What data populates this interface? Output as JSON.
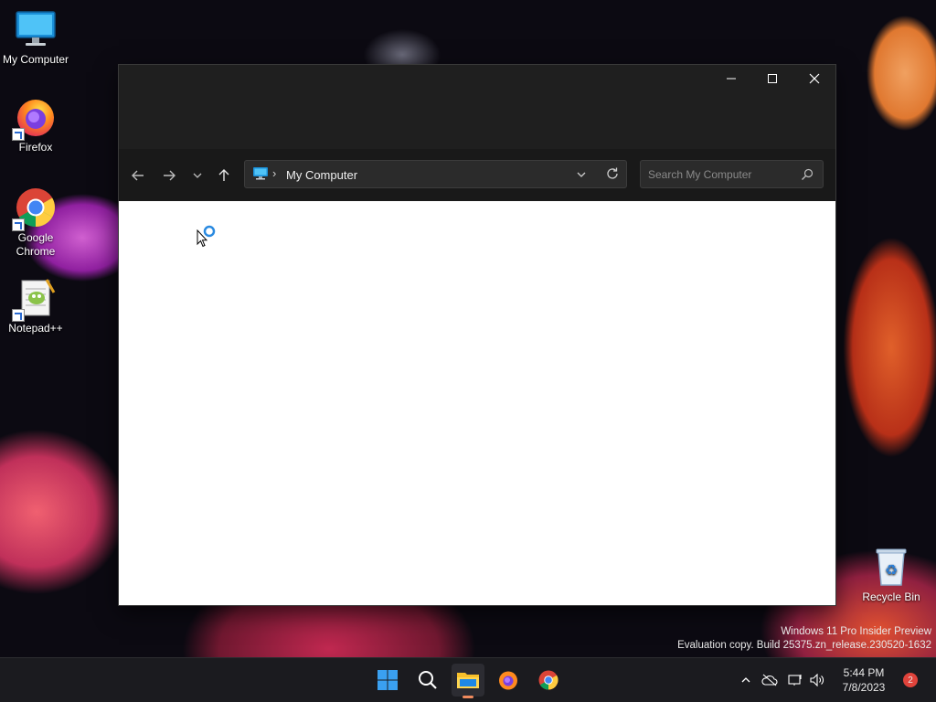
{
  "desktop": {
    "icons": [
      {
        "label": "My Computer"
      },
      {
        "label": "Firefox"
      },
      {
        "label": "Google Chrome"
      },
      {
        "label": "Notepad++"
      }
    ],
    "recycle_bin": {
      "label": "Recycle Bin"
    }
  },
  "window": {
    "address": {
      "location": "My Computer",
      "separator": "›"
    },
    "search": {
      "placeholder": "Search My Computer"
    },
    "controls": {
      "minimize": "—",
      "maximize": "☐",
      "close": "✕"
    }
  },
  "watermark": {
    "line1": "Windows 11 Pro Insider Preview",
    "line2": "Evaluation copy. Build 25375.zn_release.230520-1632"
  },
  "taskbar": {
    "clock": {
      "time": "5:44 PM",
      "date": "7/8/2023"
    },
    "notification_count": "2"
  },
  "colors": {
    "accent": "#0078d4",
    "taskbar_bg": "#1b1b1f",
    "window_bg": "#1c1c1c",
    "notification_badge": "#e0433b"
  }
}
